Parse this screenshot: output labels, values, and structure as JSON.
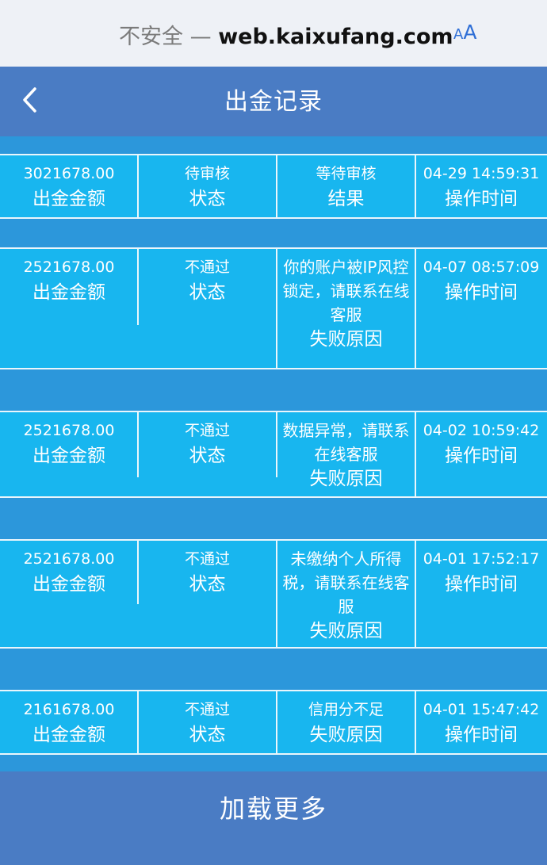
{
  "browser": {
    "insecure_label": "不安全 —",
    "domain": "web.kaixufang.com",
    "text_size_small": "A",
    "text_size_large": "A"
  },
  "nav": {
    "back_icon": "chevron-left-icon",
    "title": "出金记录"
  },
  "labels": {
    "amount": "出金金额",
    "status": "状态",
    "result": "结果",
    "fail_reason": "失败原因",
    "time": "操作时间"
  },
  "records": [
    {
      "amount": "3021678.00",
      "status": "待审核",
      "note": "等待审核",
      "note_label": "结果",
      "time": "04-29 14:59:31"
    },
    {
      "amount": "2521678.00",
      "status": "不通过",
      "note": "你的账户被IP风控锁定，请联系在线客服",
      "note_label": "失败原因",
      "time": "04-07 08:57:09"
    },
    {
      "amount": "2521678.00",
      "status": "不通过",
      "note": "数据异常，请联系在线客服",
      "note_label": "失败原因",
      "time": "04-02 10:59:42"
    },
    {
      "amount": "2521678.00",
      "status": "不通过",
      "note": "未缴纳个人所得税，请联系在线客服",
      "note_label": "失败原因",
      "time": "04-01 17:52:17"
    },
    {
      "amount": "2161678.00",
      "status": "不通过",
      "note": "信用分不足",
      "note_label": "失败原因",
      "time": "04-01 15:47:42"
    }
  ],
  "load_more": "加载更多",
  "colors": {
    "header": "#4a7cc4",
    "band": "#2c97db",
    "card": "#18b6ef",
    "divider": "#eaf6fc"
  }
}
